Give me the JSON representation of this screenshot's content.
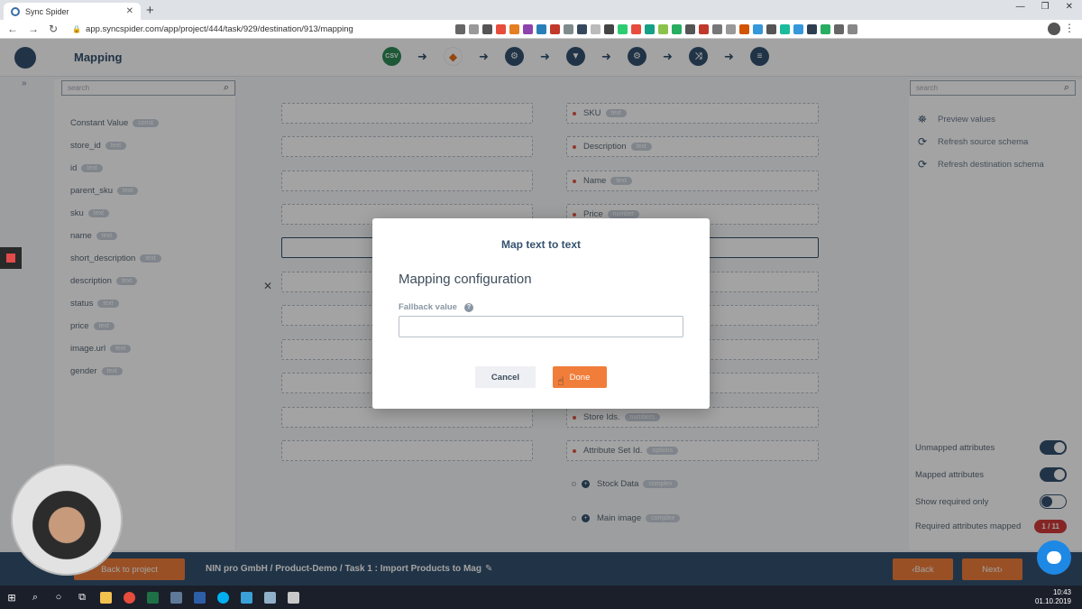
{
  "browser": {
    "tab_title": "Sync Spider",
    "url": "app.syncspider.com/app/project/444/task/929/destination/913/mapping"
  },
  "header": {
    "title": "Mapping",
    "steps": [
      "CSV",
      "Magento",
      "settings",
      "filter",
      "settings",
      "shuffle",
      "options"
    ]
  },
  "left_panel": {
    "search_placeholder": "search",
    "items": [
      {
        "name": "Constant Value",
        "type": "const"
      },
      {
        "name": "store_id",
        "type": "text"
      },
      {
        "name": "id",
        "type": "text"
      },
      {
        "name": "parent_sku",
        "type": "text"
      },
      {
        "name": "sku",
        "type": "text"
      },
      {
        "name": "name",
        "type": "text"
      },
      {
        "name": "short_description",
        "type": "text"
      },
      {
        "name": "description",
        "type": "text"
      },
      {
        "name": "status",
        "type": "text"
      },
      {
        "name": "price",
        "type": "text"
      },
      {
        "name": "image.url",
        "type": "text"
      },
      {
        "name": "gender",
        "type": "text"
      }
    ]
  },
  "destination": {
    "fields": [
      {
        "name": "SKU",
        "type": "text"
      },
      {
        "name": "Description",
        "type": "text"
      },
      {
        "name": "Name",
        "type": "text"
      },
      {
        "name": "Price",
        "type": "number"
      },
      {
        "name": "Store Ids.",
        "type": "numbers"
      },
      {
        "name": "Attribute Set Id.",
        "type": "options"
      },
      {
        "name": "Stock Data",
        "type": "complex"
      },
      {
        "name": "Main image",
        "type": "complex"
      }
    ]
  },
  "right_panel": {
    "search_placeholder": "search",
    "actions": [
      "Preview values",
      "Refresh source schema",
      "Refresh destination schema"
    ],
    "toggles": [
      {
        "label": "Unmapped attributes",
        "state": "on"
      },
      {
        "label": "Mapped attributes",
        "state": "on"
      },
      {
        "label": "Show required only",
        "state": "off"
      }
    ],
    "required_label": "Required attributes mapped",
    "required_count": "1 / 11"
  },
  "footer": {
    "back_to_project": "Back to project",
    "breadcrumb": "NIN pro GmbH  / Product-Demo  / Task 1 : Import Products to Mag",
    "back": "Back",
    "next": "Next"
  },
  "modal": {
    "title": "Map text to text",
    "subtitle": "Mapping configuration",
    "fallback_label": "Fallback value",
    "fallback_value": "",
    "cancel": "Cancel",
    "done": "Done"
  },
  "taskbar": {
    "time": "10:43",
    "date": "01.10.2019"
  }
}
